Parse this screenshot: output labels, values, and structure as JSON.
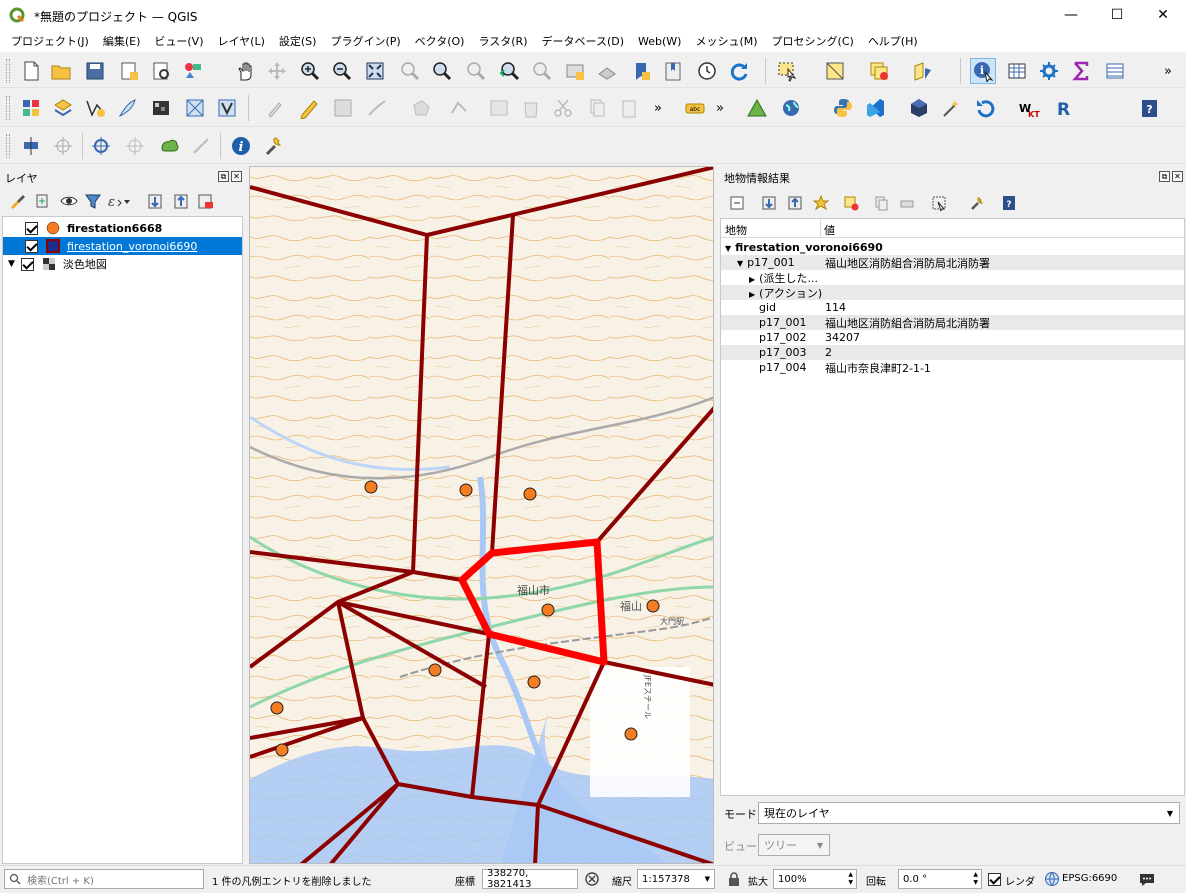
{
  "window": {
    "title": "*無題のプロジェクト — QGIS",
    "minimize": "—",
    "maximize": "☐",
    "close": "✕"
  },
  "menu": [
    "プロジェクト(J)",
    "編集(E)",
    "ビュー(V)",
    "レイヤ(L)",
    "設定(S)",
    "プラグイン(P)",
    "ベクタ(O)",
    "ラスタ(R)",
    "データベース(D)",
    "Web(W)",
    "メッシュ(M)",
    "プロセシング(C)",
    "ヘルプ(H)"
  ],
  "colors": {
    "accent": "#0078d7",
    "voronoi": "#8b0000",
    "selected": "#ff0000",
    "station": "#f57c20"
  },
  "layers_panel": {
    "title": "レイヤ",
    "layers": [
      {
        "name": "firestation6668",
        "checked": true,
        "symbol": "orange-point"
      },
      {
        "name": "firestation_voronoi6690",
        "checked": true,
        "symbol": "red-polygon",
        "selected": true
      },
      {
        "name": "淡色地図",
        "checked": true,
        "symbol": "raster"
      }
    ]
  },
  "map": {
    "labels": [
      {
        "text": "福山市",
        "kind": "city"
      },
      {
        "text": "福山",
        "kind": "town"
      },
      {
        "text": "大門駅",
        "kind": "station"
      },
      {
        "text": "JFEスチール",
        "kind": "factory"
      }
    ]
  },
  "results_panel": {
    "title": "地物情報結果",
    "col_feature": "地物",
    "col_value": "値",
    "rows": [
      {
        "key": "firestation_voronoi6690",
        "value": "",
        "level": 0,
        "expander": "▼",
        "bold": true
      },
      {
        "key": "p17_001",
        "value": "福山地区消防組合消防局北消防署",
        "level": 1,
        "expander": "▼"
      },
      {
        "key": "(派生した...",
        "value": "",
        "level": 2,
        "expander": "▶"
      },
      {
        "key": "(アクション)",
        "value": "",
        "level": 2,
        "expander": "▶"
      },
      {
        "key": "gid",
        "value": "114",
        "level": 3,
        "expander": ""
      },
      {
        "key": "p17_001",
        "value": "福山地区消防組合消防局北消防署",
        "level": 3,
        "expander": ""
      },
      {
        "key": "p17_002",
        "value": "34207",
        "level": 3,
        "expander": ""
      },
      {
        "key": "p17_003",
        "value": "2",
        "level": 3,
        "expander": ""
      },
      {
        "key": "p17_004",
        "value": "福山市奈良津町2-1-1",
        "level": 3,
        "expander": ""
      }
    ],
    "mode_label": "モード",
    "mode_value": "現在のレイヤ",
    "view_label": "ビュー",
    "view_value": "ツリー"
  },
  "statusbar": {
    "search_placeholder": "検索(Ctrl + K)",
    "message": "1 件の凡例エントリを削除しました",
    "coord_label": "座標",
    "coord_value": "338270, 3821413",
    "scale_label": "縮尺",
    "scale_value": "1:157378",
    "magnify_label": "拡大",
    "magnify_value": "100%",
    "rotation_label": "回転",
    "rotation_value": "0.0 °",
    "render_label": "レンダ",
    "crs": "EPSG:6690"
  }
}
